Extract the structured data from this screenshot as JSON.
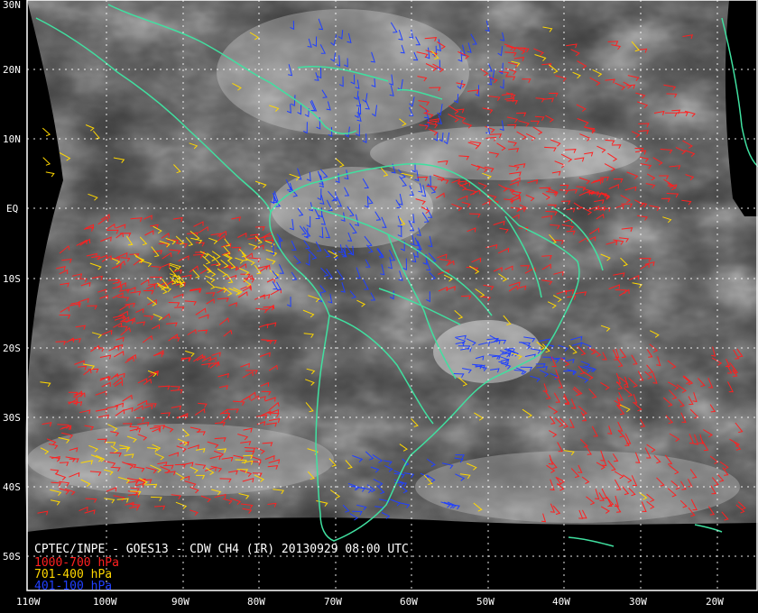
{
  "image": {
    "caption": "CPTEC/INPE - GOES13 - CDW CH4 (IR) 20130929 08:00 UTC"
  },
  "legend": [
    {
      "label": "1000-700 hPa",
      "color": "#ff2020"
    },
    {
      "label": "701-400 hPa",
      "color": "#ffd700"
    },
    {
      "label": "401-100 hPa",
      "color": "#2040ff"
    }
  ],
  "axes": {
    "lon_labels": [
      "110W",
      "100W",
      "90W",
      "80W",
      "70W",
      "60W",
      "50W",
      "40W",
      "30W",
      "20W"
    ],
    "lat_labels": [
      "30N",
      "20N",
      "10N",
      "EQ",
      "10S",
      "20S",
      "30S",
      "40S",
      "50S"
    ]
  },
  "colors": {
    "coastline": "#40e0a0",
    "grid": "#ffffff",
    "frame": "#ffffff",
    "space": "#000000"
  }
}
